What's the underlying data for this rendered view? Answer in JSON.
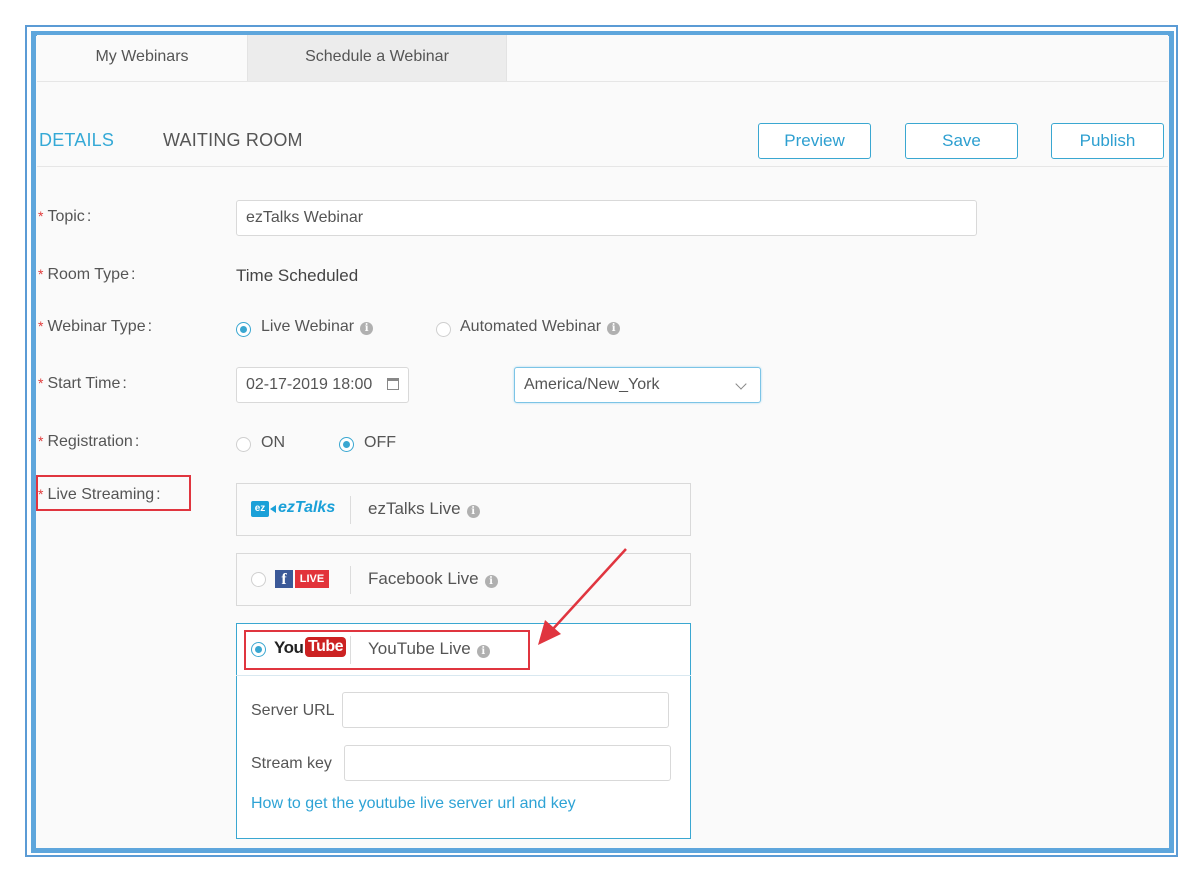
{
  "tabs": [
    {
      "label": "My Webinars"
    },
    {
      "label": "Schedule a Webinar"
    }
  ],
  "subnav": {
    "details": "DETAILS",
    "waiting_room": "WAITING ROOM",
    "preview": "Preview",
    "save": "Save",
    "publish": "Publish"
  },
  "form": {
    "required_mark": "*",
    "topic_label": "Topic",
    "topic_value": "ezTalks Webinar",
    "room_type_label": "Room Type",
    "room_type_value": "Time Scheduled",
    "webinar_type_label": "Webinar Type",
    "webinar_type_options": [
      "Live Webinar",
      "Automated Webinar"
    ],
    "webinar_type_selected": "Live Webinar",
    "start_time_label": "Start Time",
    "start_time_value": "02-17-2019 18:00",
    "timezone_value": "America/New_York",
    "registration_label": "Registration",
    "registration_options": [
      "ON",
      "OFF"
    ],
    "registration_selected": "OFF",
    "live_streaming_label": "Live Streaming",
    "colon": ":"
  },
  "streaming": {
    "eztalks": {
      "logo_badge": "ez",
      "logo_word": "ezTalks",
      "name": "ezTalks Live"
    },
    "facebook": {
      "logo_f": "f",
      "logo_live": "LIVE",
      "name": "Facebook Live"
    },
    "youtube": {
      "logo_you": "You",
      "logo_tube": "Tube",
      "name": "YouTube Live",
      "selected": true
    },
    "server_url_label": "Server URL",
    "stream_key_label": "Stream key",
    "help_link": "How to get the youtube live server url and key"
  },
  "info_glyph": "i",
  "colors": {
    "accent": "#3aa7d1",
    "highlight": "#e0353f",
    "frame": "#5ea6dc"
  }
}
